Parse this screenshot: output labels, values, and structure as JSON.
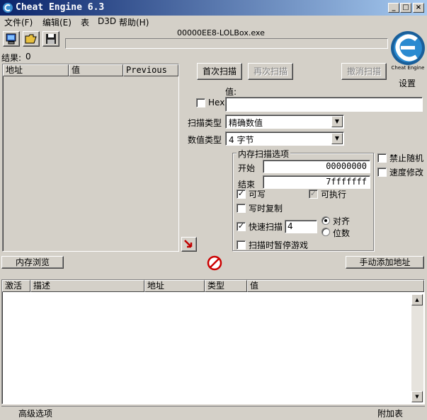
{
  "window": {
    "title": "Cheat Engine 6.3"
  },
  "menu": [
    "文件(F)",
    "编辑(E)",
    "表",
    "D3D",
    "帮助(H)"
  ],
  "process_name": "00000EE8-LOLBox.exe",
  "results": {
    "label": "结果:",
    "count": "0"
  },
  "found_list": {
    "columns": [
      "地址",
      "值",
      "Previous"
    ]
  },
  "scan": {
    "first_scan": "首次扫描",
    "next_scan": "再次扫描",
    "undo_scan": "撤消扫描",
    "settings": "设置",
    "value_label": "值:",
    "hex_label": "Hex",
    "value_input": "",
    "scan_type_label": "扫描类型",
    "scan_type_value": "精确数值",
    "value_type_label": "数值类型",
    "value_type_value": "4 字节"
  },
  "memory_options": {
    "title": "内存扫描选项",
    "start_label": "开始",
    "start_value": "00000000",
    "stop_label": "结束",
    "stop_value": "7fffffff",
    "writable": "可写",
    "executable": "可执行",
    "copy_on_write": "写时复制",
    "fast_scan": "快速扫描",
    "fast_scan_value": "4",
    "align": "对齐",
    "last_digits": "位数",
    "pause_game": "扫描时暂停游戏"
  },
  "side_options": {
    "disable_random": "禁止随机",
    "speedhack": "速度修改"
  },
  "buttons": {
    "memory_view": "内存浏览",
    "add_address": "手动添加地址"
  },
  "address_list": {
    "columns": [
      "激活",
      "描述",
      "地址",
      "类型",
      "值"
    ]
  },
  "footer": {
    "advanced": "高级选项",
    "table_extras": "附加表"
  },
  "logo": {
    "text": "Cheat Engine"
  },
  "colors": {
    "title_start": "#0a246a",
    "title_end": "#a6caf0",
    "logo_blue": "#1f6fa8",
    "stop_red": "#cc0000"
  }
}
